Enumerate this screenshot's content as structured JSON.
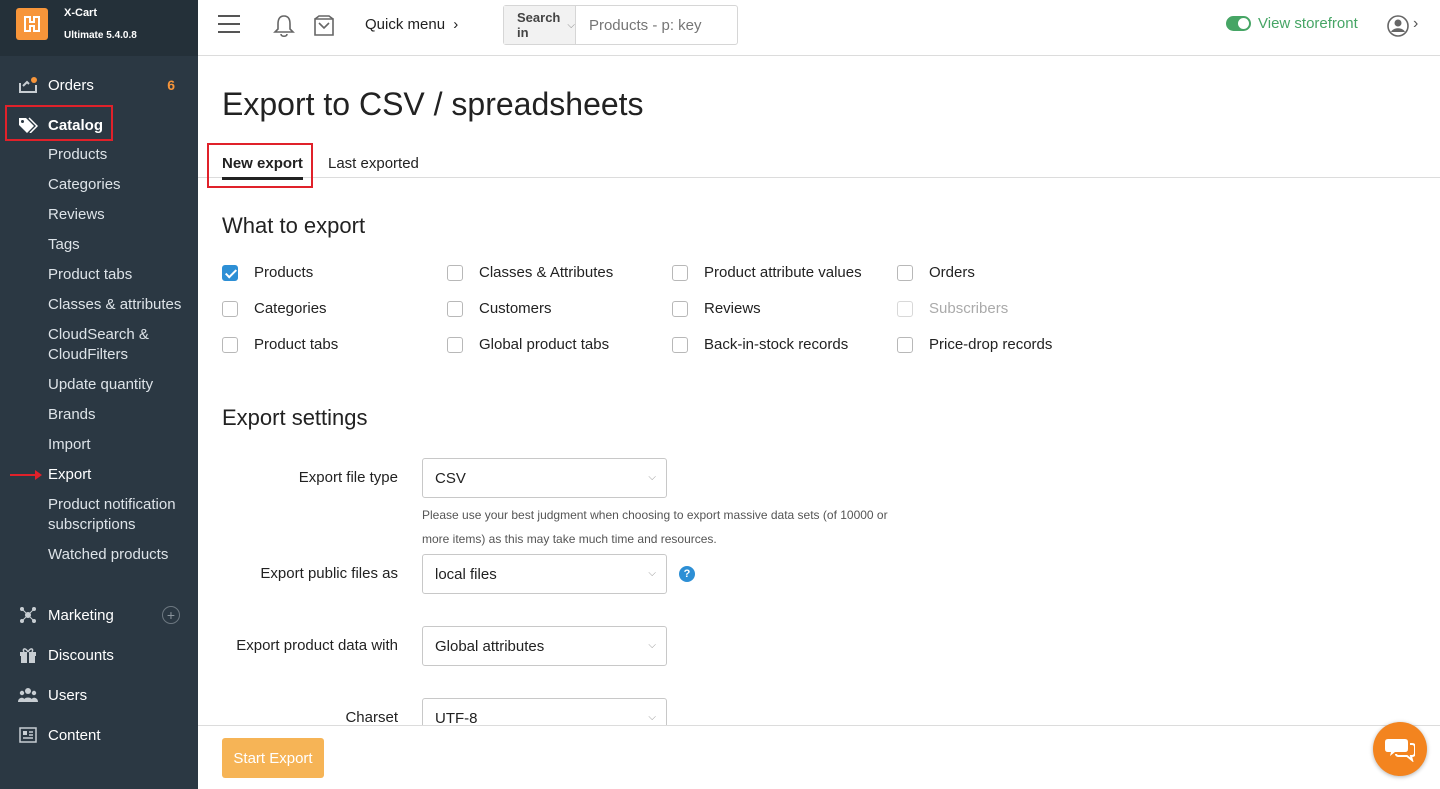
{
  "brand": {
    "name": "X-Cart",
    "version": "Ultimate 5.4.0.8",
    "accent": "#f7953a"
  },
  "sidebar": {
    "orders": {
      "label": "Orders",
      "badge": "6"
    },
    "catalog": {
      "label": "Catalog"
    },
    "catalog_items": [
      "Products",
      "Categories",
      "Reviews",
      "Tags",
      "Product tabs",
      "Classes & attributes",
      "CloudSearch &",
      "CloudFilters",
      "Update quantity",
      "Brands",
      "Import",
      "Export",
      "Product notification",
      "subscriptions",
      "Watched products"
    ],
    "marketing": {
      "label": "Marketing",
      "plus": "+"
    },
    "discounts": {
      "label": "Discounts"
    },
    "users": {
      "label": "Users"
    },
    "content": {
      "label": "Content"
    }
  },
  "header": {
    "quick_menu": "Quick menu",
    "quick_menu_chevron": "›",
    "search_in": "Search in",
    "search_chevron": "⌵",
    "search_placeholder": "Products - p: key",
    "view_storefront": "View storefront",
    "user_chevron": "›"
  },
  "page": {
    "title": "Export to CSV / spreadsheets",
    "tabs": [
      "New export",
      "Last exported"
    ]
  },
  "what_to_export": {
    "title": "What to export",
    "options": [
      {
        "label": "Products",
        "checked": true
      },
      {
        "label": "Classes & Attributes",
        "checked": false
      },
      {
        "label": "Product attribute values",
        "checked": false
      },
      {
        "label": "Orders",
        "checked": false
      },
      {
        "label": "Categories",
        "checked": false
      },
      {
        "label": "Customers",
        "checked": false
      },
      {
        "label": "Reviews",
        "checked": false
      },
      {
        "label": "Subscribers",
        "checked": false,
        "disabled": true
      },
      {
        "label": "Product tabs",
        "checked": false
      },
      {
        "label": "Global product tabs",
        "checked": false
      },
      {
        "label": "Back-in-stock records",
        "checked": false
      },
      {
        "label": "Price-drop records",
        "checked": false
      }
    ]
  },
  "export_settings": {
    "title": "Export settings",
    "file_type": {
      "label": "Export file type",
      "value": "CSV"
    },
    "help_text_1": "Please use your best judgment when choosing to export massive data sets (of 10000 or",
    "help_text_2": "more items) as this may take much time and resources.",
    "public_files": {
      "label": "Export public files as",
      "value": "local files",
      "help": "?"
    },
    "product_data": {
      "label": "Export product data with",
      "value": "Global attributes"
    },
    "charset": {
      "label": "Charset",
      "value": "UTF-8"
    },
    "dropdown_glyph": "⌵"
  },
  "footer": {
    "start_export": "Start Export"
  },
  "colors": {
    "sidebar_bg": "#2b3843",
    "accent_orange": "#f7953a",
    "checkbox_blue": "#2d8fd5",
    "storefront_green": "#46a565",
    "highlight_red": "#e0212a"
  }
}
